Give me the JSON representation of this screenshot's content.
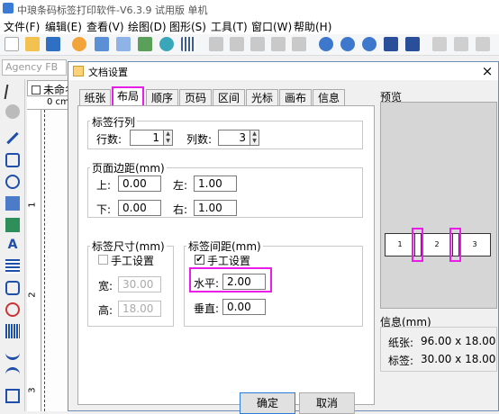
{
  "app": {
    "title": "中琅条码标签打印软件-V6.3.9 试用版 单机"
  },
  "menu": [
    "文件(F)",
    "编辑(E)",
    "查看(V)",
    "绘图(D)",
    "图形(S)",
    "工具(T)",
    "窗口(W)",
    "帮助(H)"
  ],
  "toolbar": {
    "font_value": "Agency FB"
  },
  "document": {
    "tab_label": "未命名",
    "ruler_h": "0 cm",
    "ruler_v_marks": [
      "1",
      "2",
      "3"
    ]
  },
  "dialog": {
    "title": "文档设置",
    "close": "×",
    "tabs": [
      "纸张",
      "布局",
      "顺序",
      "页码",
      "区间",
      "光标",
      "画布",
      "信息"
    ],
    "active_tab": "布局",
    "label_rows": {
      "legend": "标签行列",
      "rows_label": "行数:",
      "rows_value": "1",
      "cols_label": "列数:",
      "cols_value": "3"
    },
    "margins": {
      "legend": "页面边距(mm)",
      "top_label": "上:",
      "top": "0.00",
      "left_label": "左:",
      "left": "1.00",
      "bottom_label": "下:",
      "bottom": "0.00",
      "right_label": "右:",
      "right": "1.00"
    },
    "label_size": {
      "legend": "标签尺寸(mm)",
      "manual_label": "手工设置",
      "manual_checked": false,
      "width_label": "宽:",
      "width": "30.00",
      "height_label": "高:",
      "height": "18.00"
    },
    "label_gap": {
      "legend": "标签间距(mm)",
      "manual_label": "手工设置",
      "manual_checked": true,
      "h_label": "水平:",
      "h_value": "2.00",
      "v_label": "垂直:",
      "v_value": "0.00"
    },
    "preview": {
      "legend": "预览",
      "labels": [
        "1",
        "2",
        "3"
      ]
    },
    "info": {
      "legend": "信息(mm)",
      "paper_label": "纸张:",
      "paper": "96.00 x 18.00",
      "label_label": "标签:",
      "label": "30.00 x 18.00"
    },
    "ok": "确定",
    "cancel": "取消"
  },
  "colors": {
    "highlight": "#e81ee8",
    "dialog_border": "#6e8cb5",
    "default_button": "#2e7bd8"
  }
}
